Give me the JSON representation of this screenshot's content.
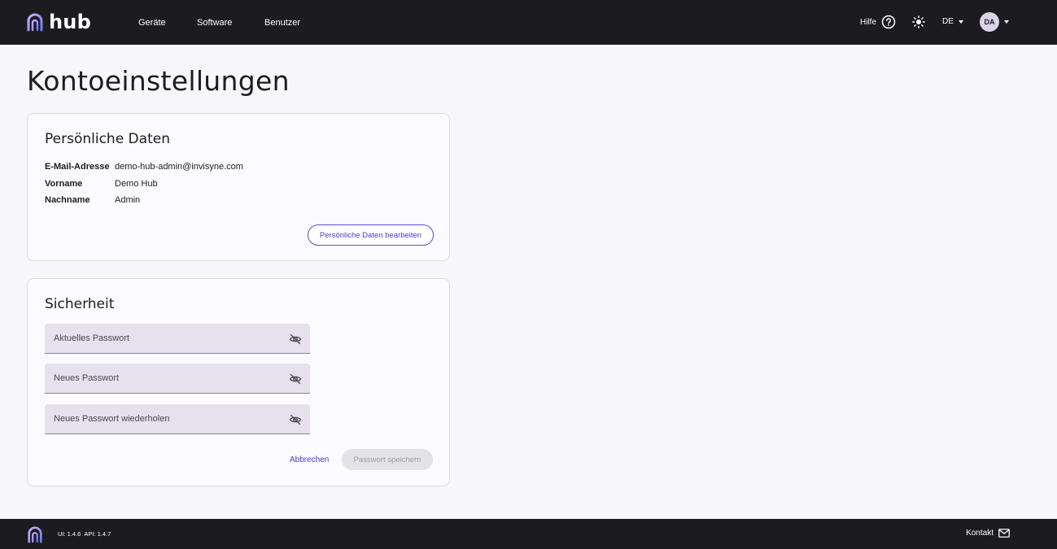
{
  "header": {
    "brand": "hub",
    "nav": [
      "Geräte",
      "Software",
      "Benutzer"
    ],
    "help_label": "Hilfe",
    "language": "DE",
    "avatar_initials": "DA"
  },
  "page": {
    "title": "Kontoeinstellungen"
  },
  "personal": {
    "title": "Persönliche Daten",
    "rows": [
      {
        "label": "E-Mail-Adresse",
        "value": "demo-hub-admin@invisyne.com"
      },
      {
        "label": "Vorname",
        "value": "Demo Hub"
      },
      {
        "label": "Nachname",
        "value": "Admin"
      }
    ],
    "edit_button": "Persönliche Daten bearbeiten"
  },
  "security": {
    "title": "Sicherheit",
    "fields": [
      {
        "placeholder": "Aktuelles Passwort"
      },
      {
        "placeholder": "Neues Passwort"
      },
      {
        "placeholder": "Neues Passwort wiederholen"
      }
    ],
    "cancel_button": "Abbrechen",
    "save_button": "Passwort speichern"
  },
  "footer": {
    "ui_version": "UI: 1.4.6",
    "api_version": "API: 1.4.7",
    "contact_label": "Kontakt"
  },
  "colors": {
    "accent": "#4a3ad0",
    "logo_gradient_start": "#c9a8ff",
    "logo_gradient_end": "#6b7cff",
    "topbar": "#1c1b1f"
  }
}
